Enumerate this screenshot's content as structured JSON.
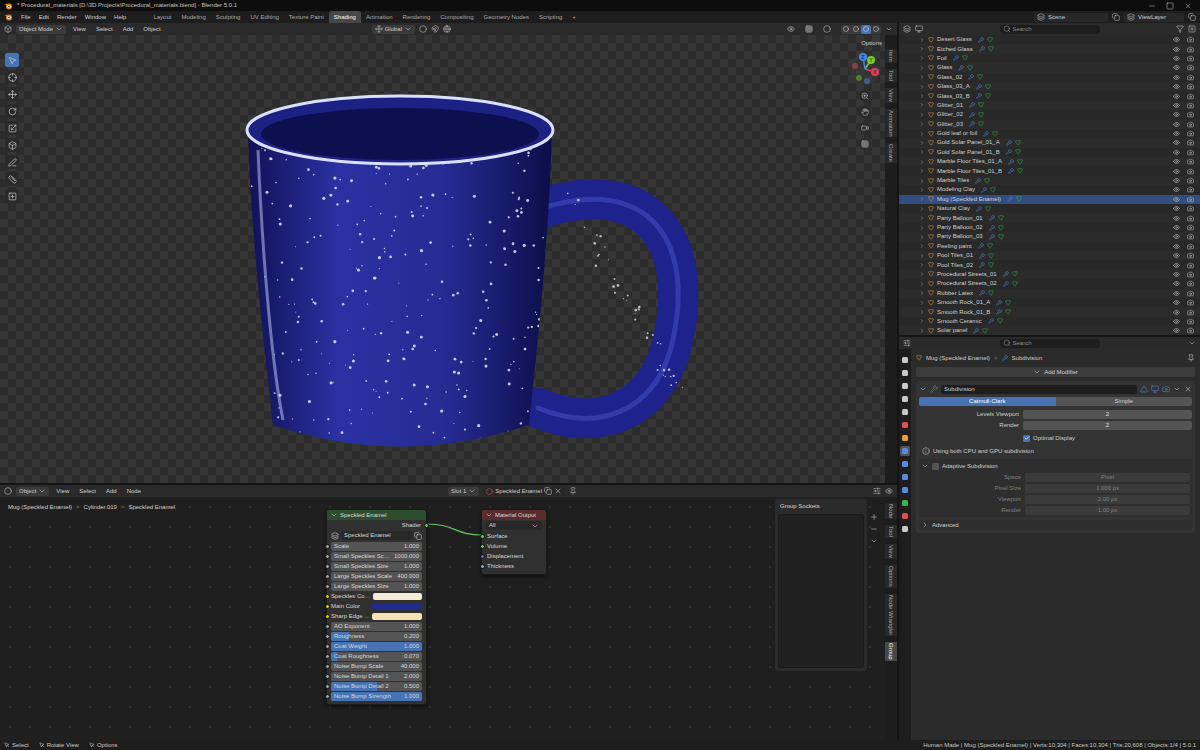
{
  "window": {
    "title": "* Procedural_materials [D:\\3D Projects\\Procedural_materials.blend] - Blender 5.0.1"
  },
  "menu": [
    "File",
    "Edit",
    "Render",
    "Window",
    "Help"
  ],
  "workspaces": [
    {
      "label": "Layout",
      "selected": false
    },
    {
      "label": "Modeling",
      "selected": false
    },
    {
      "label": "Sculpting",
      "selected": false
    },
    {
      "label": "UV Editing",
      "selected": false
    },
    {
      "label": "Texture Paint",
      "selected": false
    },
    {
      "label": "Shading",
      "selected": true
    },
    {
      "label": "Animation",
      "selected": false
    },
    {
      "label": "Rendering",
      "selected": false
    },
    {
      "label": "Compositing",
      "selected": false
    },
    {
      "label": "Geometry Nodes",
      "selected": false
    },
    {
      "label": "Scripting",
      "selected": false
    }
  ],
  "add_workspace": "+",
  "scene": "Scene",
  "view_layer": "ViewLayer",
  "viewport": {
    "mode": "Object Mode",
    "menus": [
      "View",
      "Select",
      "Add",
      "Object"
    ],
    "orientation": "Global",
    "options": "Options",
    "shading_modes": [
      {
        "selected": false
      },
      {
        "selected": false
      },
      {
        "selected": true
      },
      {
        "selected": false
      }
    ],
    "toolbar": [
      {
        "selected": true
      },
      {
        "selected": false
      },
      {
        "selected": false
      },
      {
        "selected": false
      },
      {
        "selected": false
      },
      {
        "selected": false
      },
      {
        "selected": false
      },
      {
        "selected": false
      },
      {
        "selected": false
      }
    ],
    "gizmo_axes": [
      {
        "label": "X",
        "color": "#e2405a"
      },
      {
        "label": "Y",
        "color": "#7ec820"
      },
      {
        "label": "Z",
        "color": "#3f86e8"
      }
    ],
    "side_tabs": [
      {
        "label": "Item",
        "selected": false
      },
      {
        "label": "Tool",
        "selected": false
      },
      {
        "label": "View",
        "selected": false
      },
      {
        "label": "Animation",
        "selected": false
      },
      {
        "label": "Create",
        "selected": false
      }
    ]
  },
  "outliner": {
    "search_placeholder": "Search",
    "items": [
      {
        "label": "Desert Glass",
        "selected": false
      },
      {
        "label": "Etched Glass",
        "selected": false
      },
      {
        "label": "Foil",
        "selected": false
      },
      {
        "label": "Glass",
        "selected": false
      },
      {
        "label": "Glass_02",
        "selected": false
      },
      {
        "label": "Glass_03_A",
        "selected": false
      },
      {
        "label": "Glass_03_B",
        "selected": false
      },
      {
        "label": "Glitter_01",
        "selected": false
      },
      {
        "label": "Glitter_02",
        "selected": false
      },
      {
        "label": "Glitter_03",
        "selected": false
      },
      {
        "label": "Gold leaf or foil",
        "selected": false
      },
      {
        "label": "Gold Solar Panel_01_A",
        "selected": false
      },
      {
        "label": "Gold Solar Panel_01_B",
        "selected": false
      },
      {
        "label": "Marble Floor Tiles_01_A",
        "selected": false
      },
      {
        "label": "Marble Floor Tiles_01_B",
        "selected": false
      },
      {
        "label": "Marble Tiles",
        "selected": false
      },
      {
        "label": "Modeling Clay",
        "selected": false
      },
      {
        "label": "Mug (Speckled Enamel)",
        "selected": true
      },
      {
        "label": "Natural Clay",
        "selected": false
      },
      {
        "label": "Party Balloon_01",
        "selected": false
      },
      {
        "label": "Party Balloon_02",
        "selected": false
      },
      {
        "label": "Party Balloon_03",
        "selected": false
      },
      {
        "label": "Peeling paint",
        "selected": false
      },
      {
        "label": "Pool Tiles_01",
        "selected": false
      },
      {
        "label": "Pool Tiles_02",
        "selected": false
      },
      {
        "label": "Procedural Streets_01",
        "selected": false
      },
      {
        "label": "Procedural Streets_02",
        "selected": false
      },
      {
        "label": "Rubber Latex",
        "selected": false
      },
      {
        "label": "Smooth Rock_01_A",
        "selected": false
      },
      {
        "label": "Smooth Rock_01_B",
        "selected": false
      },
      {
        "label": "Smooth Ceramic",
        "selected": false
      },
      {
        "label": "Solar panel",
        "selected": false
      }
    ]
  },
  "properties": {
    "search_placeholder": "Search",
    "tabs": [
      {
        "selected": false,
        "color": "#c8c8c8"
      },
      {
        "selected": false,
        "color": "#c8c8c8"
      },
      {
        "selected": false,
        "color": "#c8c8c8"
      },
      {
        "selected": false,
        "color": "#c8c8c8"
      },
      {
        "selected": false,
        "color": "#c8c8c8"
      },
      {
        "selected": false,
        "color": "#e05050"
      },
      {
        "selected": false,
        "color": "#e8a03c"
      },
      {
        "selected": true,
        "color": "#5a8ae0"
      },
      {
        "selected": false,
        "color": "#5a8ae0"
      },
      {
        "selected": false,
        "color": "#5a8ae0"
      },
      {
        "selected": false,
        "color": "#5a8ae0"
      },
      {
        "selected": false,
        "color": "#35b550"
      },
      {
        "selected": false,
        "color": "#e05050"
      },
      {
        "selected": false,
        "color": "#c8c8c8"
      }
    ],
    "breadcrumb": [
      "Mug (Speckled Enamel)",
      "Subdivision"
    ],
    "breadcrumb_separator": ">",
    "add_modifier": "Add Modifier",
    "modifier": {
      "name": "Subdivision",
      "expanded": true,
      "modes": [
        {
          "label": "Catmull-Clark",
          "selected": true
        },
        {
          "label": "Simple",
          "selected": false
        }
      ],
      "levels": [
        {
          "label": "Levels Viewport",
          "value": "2",
          "disabled": false
        },
        {
          "label": "Render",
          "value": "2",
          "disabled": false
        }
      ],
      "optimal_display": {
        "label": "Optimal Display",
        "checked": true
      },
      "note": "Using both CPU and GPU subdivision",
      "adaptive": {
        "label": "Adaptive Subdivision",
        "expanded": true,
        "checked": false,
        "fields": [
          {
            "label": "Space",
            "value": "Pixel",
            "disabled": true
          },
          {
            "label": "Pixel Size",
            "value": "1.000 px",
            "disabled": true
          },
          {
            "label": "Viewport",
            "value": "2.00 px",
            "disabled": true
          },
          {
            "label": "Render",
            "value": "1.00 px",
            "disabled": true
          }
        ]
      },
      "advanced": {
        "label": "Advanced",
        "expanded": false
      }
    }
  },
  "node_editor": {
    "object_menu": "Object",
    "menus": [
      "View",
      "Select",
      "Add",
      "Node"
    ],
    "slot": "Slot 1",
    "material": "Speckled Enamel",
    "breadcrumb": [
      "Mug (Speckled Enamel)",
      "Cylinder.019",
      "Speckled Enamel"
    ],
    "breadcrumb_separator": ">",
    "group_node": {
      "title": "Speckled Enamel",
      "output": {
        "label": "Shader",
        "color": "#63c763"
      },
      "datablock": "Speckled Enamel",
      "inputs": [
        {
          "label": "Scale",
          "value": "1.000",
          "kind": "value",
          "color": "#a1a1a1"
        },
        {
          "label": "Small Speckles Sc…",
          "value": "1000.000",
          "kind": "value",
          "color": "#a1a1a1"
        },
        {
          "label": "Small Speckles Size",
          "value": "1.000",
          "kind": "value",
          "color": "#a1a1a1"
        },
        {
          "label": "Large Speckles Scale",
          "value": "400.000",
          "kind": "value",
          "color": "#a1a1a1"
        },
        {
          "label": "Large Speckles Size",
          "value": "1.000",
          "kind": "value",
          "color": "#a1a1a1"
        },
        {
          "label": "Speckles Co…",
          "kind": "color",
          "swatch": "#f3ecd6",
          "color": "#c7c729"
        },
        {
          "label": "Main Color",
          "kind": "color",
          "swatch": "#1f2a8c",
          "color": "#c7c729"
        },
        {
          "label": "Sharp Edge …",
          "kind": "color",
          "swatch": "#f6e3b4",
          "color": "#c7c729"
        },
        {
          "label": "AO Exponent",
          "value": "1.000",
          "kind": "value",
          "color": "#a1a1a1"
        },
        {
          "label": "Roughness",
          "value": "0.200",
          "kind": "slider",
          "level": 0.2,
          "color": "#a1a1a1"
        },
        {
          "label": "Coat Weight",
          "value": "1.000",
          "kind": "slider",
          "level": 1,
          "color": "#a1a1a1"
        },
        {
          "label": "Coat Roughness",
          "value": "0.070",
          "kind": "slider",
          "level": 0.07,
          "color": "#a1a1a1"
        },
        {
          "label": "Noise Bump Scale",
          "value": "40.000",
          "kind": "value",
          "color": "#a1a1a1"
        },
        {
          "label": "Noise Bump Detail 1",
          "value": "2.000",
          "kind": "value",
          "color": "#a1a1a1"
        },
        {
          "label": "Noise Bump Detail 2",
          "value": "0.500",
          "kind": "slider",
          "level": 0.5,
          "color": "#a1a1a1"
        },
        {
          "label": "Noise Bump Strength",
          "value": "1.000",
          "kind": "slider",
          "level": 1,
          "color": "#a1a1a1"
        }
      ]
    },
    "output_node": {
      "title": "Material Output",
      "target": "All",
      "sockets": [
        {
          "label": "Surface",
          "color": "#63c763"
        },
        {
          "label": "Volume",
          "color": "#63c763"
        },
        {
          "label": "Displacement",
          "color": "#6363c7"
        },
        {
          "label": "Thickness",
          "color": "#a1a1a1"
        }
      ]
    },
    "group_sockets": {
      "title": "Group Sockets"
    },
    "side_tabs": [
      {
        "label": "Node",
        "selected": false
      },
      {
        "label": "Tool",
        "selected": false
      },
      {
        "label": "View",
        "selected": false
      },
      {
        "label": "Options",
        "selected": false
      },
      {
        "label": "Node Wrangler",
        "selected": false
      },
      {
        "label": "Group",
        "selected": true
      }
    ]
  },
  "status_bar": {
    "hints": [
      "Select",
      "Rotate View",
      "Options"
    ],
    "info": "Human Made | Mug (Speckled Enamel) | Verts:10,304 | Faces:10,304 | Tris:20,608 | Objects:1/4 | 5.0.1"
  }
}
